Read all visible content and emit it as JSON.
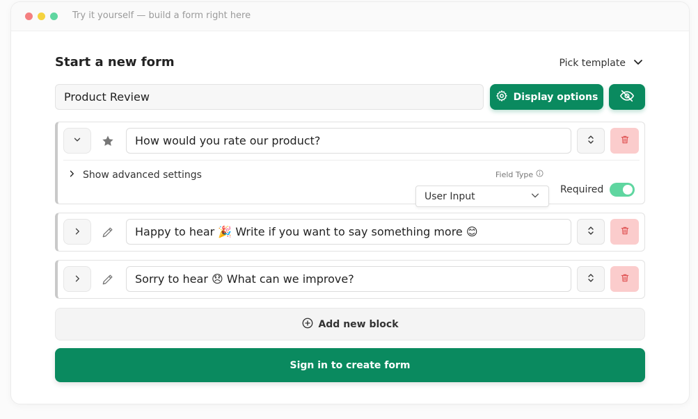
{
  "window": {
    "title": "Try it yourself — build a form right here"
  },
  "header": {
    "title": "Start a new form",
    "pick_template": "Pick template"
  },
  "form": {
    "name": "Product Review"
  },
  "toolbar": {
    "display_options": "Display options"
  },
  "blocks": [
    {
      "question": "How would you rate our product?",
      "icon": "star-icon",
      "expanded": true,
      "advanced_label": "Show advanced settings",
      "field_type_label": "Field Type",
      "field_type_value": "User Input",
      "required_label": "Required",
      "required": true
    },
    {
      "question": "Happy to hear 🎉 Write if you want to say something more 😊",
      "icon": "pencil-icon",
      "expanded": false
    },
    {
      "question": "Sorry to hear 😞  What can we improve?",
      "icon": "pencil-icon",
      "expanded": false
    }
  ],
  "actions": {
    "add_block": "Add new block",
    "sign_in": "Sign in to create form"
  },
  "colors": {
    "accent": "#0a8a5f",
    "delete_bg": "#fbcccc",
    "toggle_on": "#5fd6a0"
  }
}
